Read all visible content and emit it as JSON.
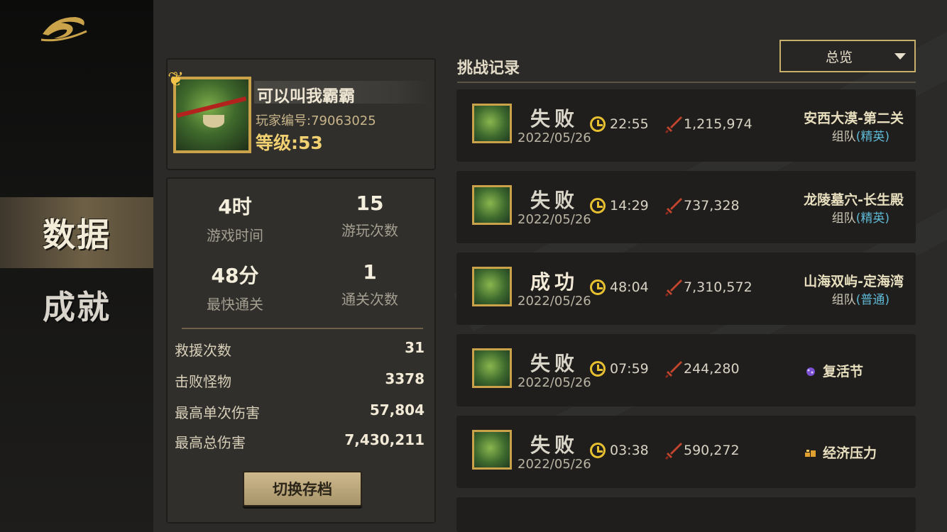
{
  "sidebar": {
    "items": [
      {
        "label": "数据",
        "active": true
      },
      {
        "label": "成就",
        "active": false
      }
    ]
  },
  "profile": {
    "name": "可以叫我霸霸",
    "player_id": "玩家编号:79063025",
    "level": "等级:53"
  },
  "stats": {
    "play_time": {
      "value": "4时",
      "label": "游戏时间"
    },
    "play_count": {
      "value": "15",
      "label": "游玩次数"
    },
    "fastest_clear": {
      "value": "48分",
      "label": "最快通关"
    },
    "clear_count": {
      "value": "1",
      "label": "通关次数"
    },
    "rows": [
      {
        "label": "救援次数",
        "value": "31"
      },
      {
        "label": "击败怪物",
        "value": "3378"
      },
      {
        "label": "最高单次伤害",
        "value": "57,804"
      },
      {
        "label": "最高总伤害",
        "value": "7,430,211"
      }
    ],
    "switch_button": "切换存档"
  },
  "records": {
    "title": "挑战记录",
    "filter": "总览",
    "items": [
      {
        "result": "失败",
        "win": false,
        "date": "2022/05/26",
        "time": "22:55",
        "damage": "1,215,974",
        "location": "安西大漠-第二关",
        "mode_prefix": "组队",
        "difficulty": "(精英)"
      },
      {
        "result": "失败",
        "win": false,
        "date": "2022/05/26",
        "time": "14:29",
        "damage": "737,328",
        "location": "龙陵墓穴-长生殿",
        "mode_prefix": "组队",
        "difficulty": "(精英)"
      },
      {
        "result": "成功",
        "win": true,
        "date": "2022/05/26",
        "time": "48:04",
        "damage": "7,310,572",
        "location": "山海双屿-定海湾",
        "mode_prefix": "组队",
        "difficulty": "(普通)"
      },
      {
        "result": "失败",
        "win": false,
        "date": "2022/05/26",
        "time": "07:59",
        "damage": "244,280",
        "event": "复活节",
        "event_icon": "easter-egg-icon"
      },
      {
        "result": "失败",
        "win": false,
        "date": "2022/05/26",
        "time": "03:38",
        "damage": "590,272",
        "event": "经济压力",
        "event_icon": "coins-icon"
      }
    ]
  },
  "colors": {
    "accent_gold": "#c9b06a",
    "difficulty_blue": "#5fb9d6",
    "clock_yellow": "#e6c030",
    "sword_red": "#c2452e"
  }
}
